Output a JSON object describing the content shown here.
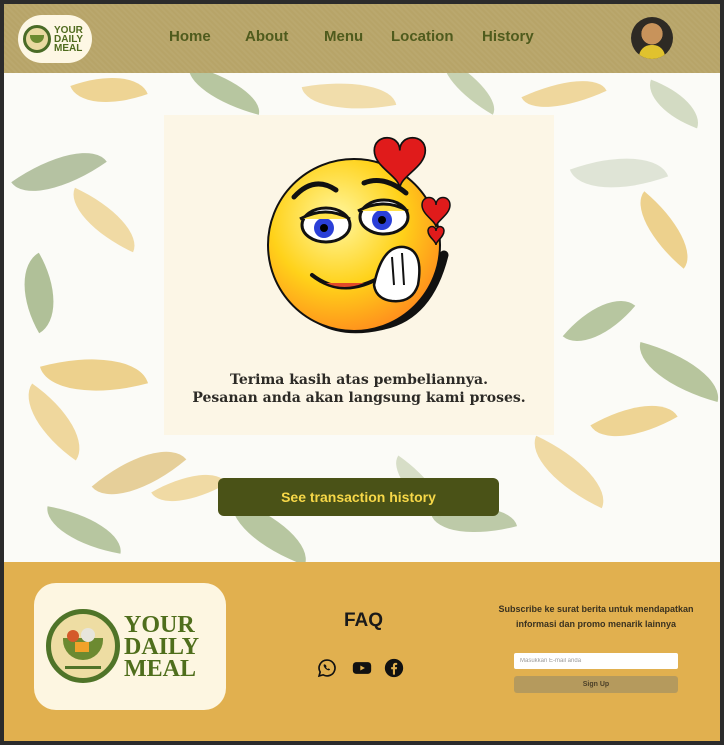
{
  "header": {
    "logo_text": "YOUR DAILY MEAL",
    "nav": [
      "Home",
      "About",
      "Menu",
      "Location",
      "History"
    ]
  },
  "hero": {
    "message_line1": "Terima kasih atas pembeliannya.",
    "message_line2": "Pesanan anda akan langsung kami proses.",
    "cta_label": "See transaction history",
    "emoji_icon": "smiling-face-with-hearts-icon"
  },
  "footer": {
    "logo_line1": "YOUR",
    "logo_line2": "DAILY",
    "logo_line3": "MEAL",
    "faq": "FAQ",
    "social_icons": [
      "whatsapp-icon",
      "youtube-icon",
      "facebook-icon"
    ],
    "subscribe_text": "Subscribe ke surat berita untuk mendapatkan informasi dan promo menarik lainnya",
    "email_placeholder": "Masukkan E-mail anda",
    "signup_label": "Sign Up"
  },
  "colors": {
    "header_bg": "#b7a468",
    "nav_text": "#4f5b1d",
    "cta_bg": "#4a5217",
    "cta_text": "#f7d848",
    "footer_bg": "#e1b04f",
    "card_bg": "#fcf6e6"
  }
}
